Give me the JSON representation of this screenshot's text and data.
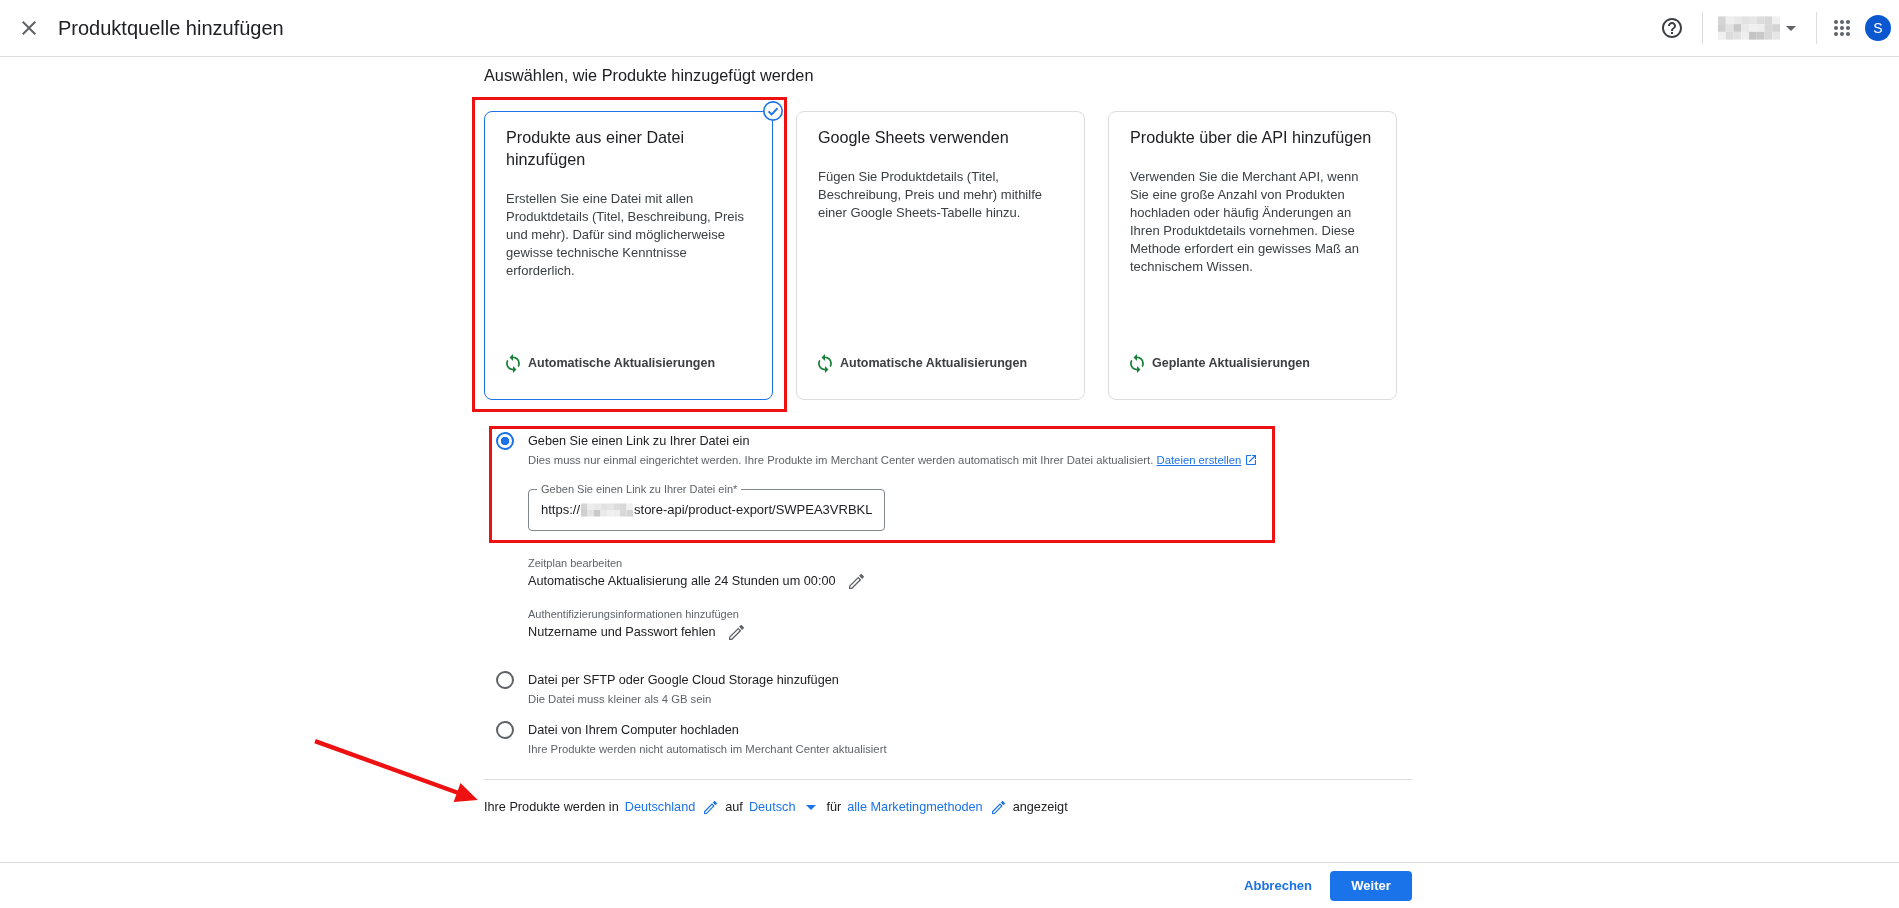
{
  "header": {
    "title": "Produktquelle hinzufügen",
    "avatar_letter": "S"
  },
  "source_section": {
    "heading": "Auswählen, wie Produkte hinzugefügt werden",
    "cards": [
      {
        "title": "Produkte aus einer Datei hinzufügen",
        "description": "Erstellen Sie eine Datei mit allen Produktdetails (Titel, Beschreibung, Preis und mehr). Dafür sind möglicherweise gewisse technische Kenntnisse erforderlich.",
        "update_mode": "Automatische Aktualisierungen",
        "selected": true,
        "highlighted": true
      },
      {
        "title": "Google Sheets verwenden",
        "description": "Fügen Sie Produktdetails (Titel, Beschreibung, Preis und mehr) mithilfe einer Google Sheets-Tabelle hinzu.",
        "update_mode": "Automatische Aktualisierungen",
        "selected": false,
        "highlighted": false
      },
      {
        "title": "Produkte über die API hinzufügen",
        "description": "Verwenden Sie die Merchant API, wenn Sie eine große Anzahl von Produkten hochladen oder häufig Änderungen an Ihren Produktdetails vornehmen. Diese Methode erfordert ein gewisses Maß an technischem Wissen.",
        "update_mode": "Geplante Aktualisierungen",
        "selected": false,
        "highlighted": false
      }
    ]
  },
  "upload_methods": [
    {
      "label": "Geben Sie einen Link zu Ihrer Datei ein",
      "description": "Dies muss nur einmal eingerichtet werden. Ihre Produkte im Merchant Center werden automatisch mit Ihrer Datei aktualisiert.",
      "link": "Dateien erstellen",
      "selected": true,
      "highlighted": true,
      "field": {
        "label": "Geben Sie einen Link zu Ihrer Datei ein*",
        "value_parts": [
          "https://",
          "store-api/product-export/SWPEA3VRBKL"
        ]
      },
      "settings": [
        {
          "label": "Zeitplan bearbeiten",
          "value": "Automatische Aktualisierung alle 24 Stunden um 00:00"
        },
        {
          "label": "Authentifizierungsinformationen hinzufügen",
          "value": "Nutzername und Passwort fehlen"
        }
      ]
    },
    {
      "label": "Datei per SFTP oder Google Cloud Storage hinzufügen",
      "description": "Die Datei muss kleiner als 4 GB sein",
      "selected": false,
      "highlighted": false
    },
    {
      "label": "Datei von Ihrem Computer hochladen",
      "description": "Ihre Produkte werden nicht automatisch im Merchant Center aktualisiert",
      "selected": false,
      "highlighted": false
    }
  ],
  "display_settings": {
    "highlighted": true,
    "parts": [
      {
        "kind": "text",
        "text": "Ihre Produkte werden in"
      },
      {
        "kind": "editable",
        "text": "Deutschland"
      },
      {
        "kind": "text",
        "text": "auf"
      },
      {
        "kind": "dropdown",
        "text": "Deutsch"
      },
      {
        "kind": "text",
        "text": "für"
      },
      {
        "kind": "editable",
        "text": "alle Marketingmethoden"
      },
      {
        "kind": "text",
        "text": "angezeigt"
      }
    ]
  },
  "footer": {
    "buttons": [
      {
        "kind": "text",
        "label": "Abbrechen"
      },
      {
        "kind": "primary",
        "label": "Weiter"
      }
    ]
  }
}
